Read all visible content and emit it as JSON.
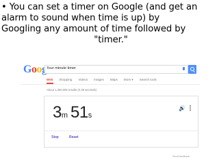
{
  "caption": {
    "lines": [
      "• You can set a timer on Google (and get an",
      "alarm to sound when time is up) by",
      "Googling  any amount of time followed by",
      "\"timer.\""
    ]
  },
  "google": {
    "logo": {
      "g1": "G",
      "o1": "o",
      "o2": "o",
      "g2": "g",
      "l": "l",
      "e": "e"
    },
    "search_query": "four minute timer",
    "tabs": [
      "Web",
      "Shopping",
      "Videos",
      "Images",
      "Maps",
      "More ▾",
      "Search tools"
    ],
    "active_tab": "Web",
    "stats": "About 1,350,000 results (0.38 seconds)",
    "timer": {
      "minutes": "3",
      "minutes_unit": "m",
      "seconds": "51",
      "seconds_unit": "s",
      "stop_label": "Stop",
      "reset_label": "Reset"
    },
    "feedback": "Send feedback"
  },
  "colors": {
    "accent_red": "#dd4b39",
    "link_blue": "#1a0dab",
    "search_blue": "#4d90fe"
  },
  "icons": [
    "mic-icon",
    "search-icon",
    "speaker-icon",
    "more-vert-icon"
  ]
}
